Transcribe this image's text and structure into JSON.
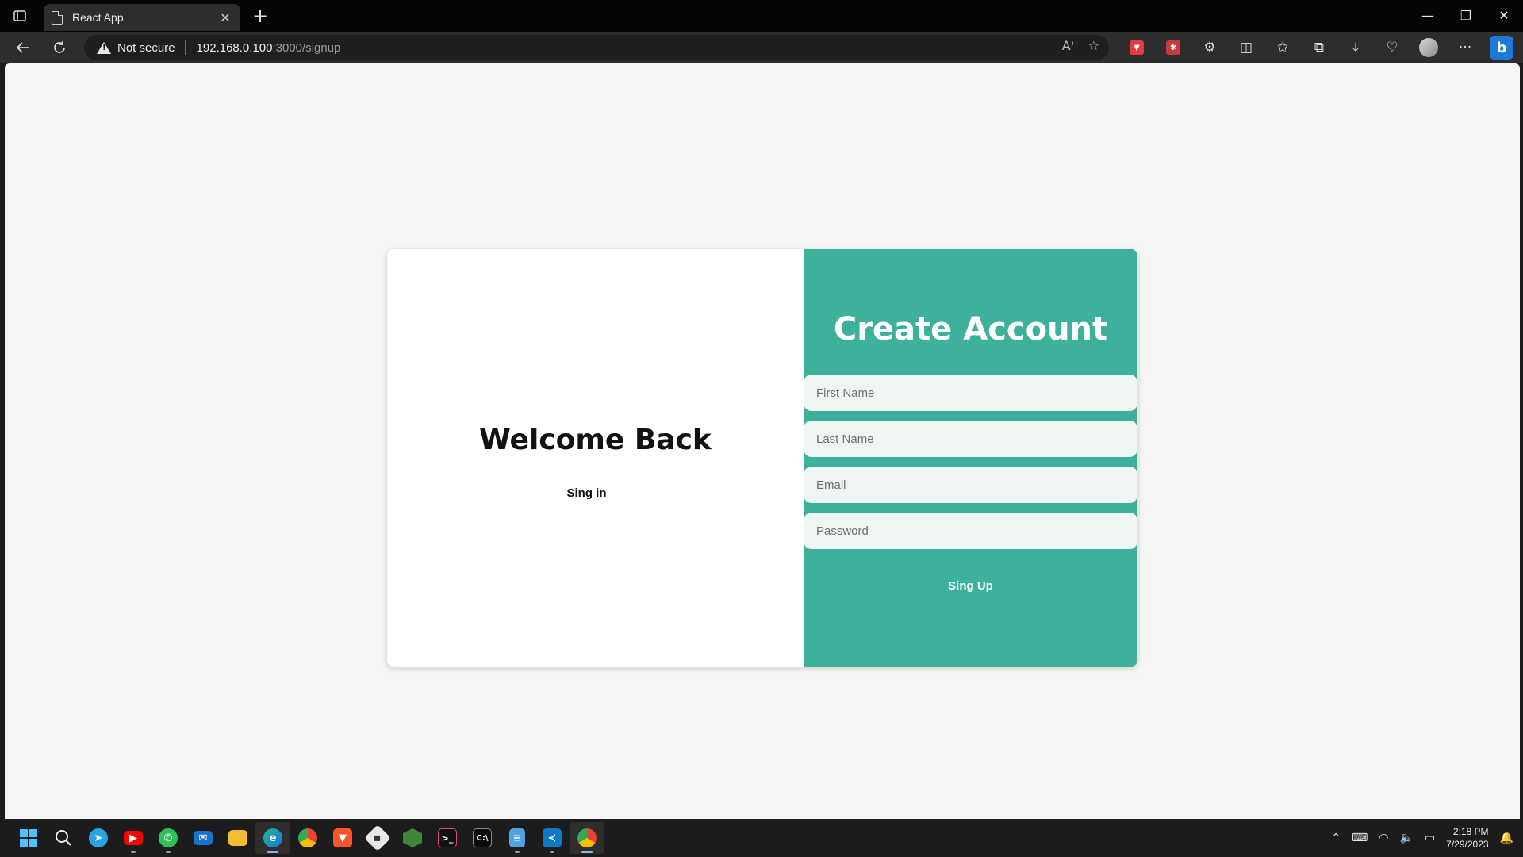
{
  "browser": {
    "tab_title": "React App",
    "security_label": "Not secure",
    "url_host": "192.168.0.100",
    "url_path": ":3000/signup"
  },
  "page": {
    "welcome_title": "Welcome Back",
    "signin_link": "Sing in",
    "create_title": "Create Account",
    "fields": {
      "first_name_placeholder": "First Name",
      "last_name_placeholder": "Last Name",
      "email_placeholder": "Email",
      "password_placeholder": "Password"
    },
    "signup_button": "Sing Up",
    "colors": {
      "accent": "#3db19c",
      "field_bg": "#eef5f3",
      "page_bg": "#f5f5f4"
    }
  },
  "taskbar": {
    "time": "2:18 PM",
    "date": "7/29/2023"
  }
}
